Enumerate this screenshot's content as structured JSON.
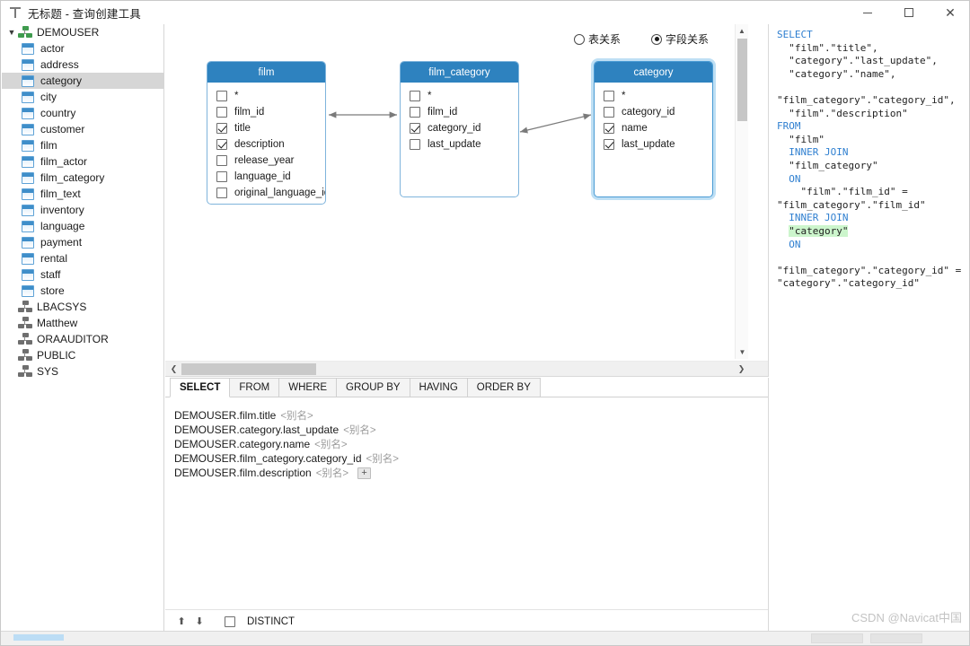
{
  "window": {
    "title": "无标题 - 查询创建工具",
    "minimize_label": "最小化",
    "maximize_label": "最大化",
    "close_label": "关闭"
  },
  "sidebar": {
    "root": {
      "label": "DEMOUSER",
      "icon": "schema-icon",
      "expanded": true
    },
    "tables": [
      {
        "label": "actor",
        "icon": "table-icon",
        "selected": false
      },
      {
        "label": "address",
        "icon": "table-icon",
        "selected": false
      },
      {
        "label": "category",
        "icon": "table-icon",
        "selected": true
      },
      {
        "label": "city",
        "icon": "table-icon",
        "selected": false
      },
      {
        "label": "country",
        "icon": "table-icon",
        "selected": false
      },
      {
        "label": "customer",
        "icon": "table-icon",
        "selected": false
      },
      {
        "label": "film",
        "icon": "table-icon",
        "selected": false
      },
      {
        "label": "film_actor",
        "icon": "table-icon",
        "selected": false
      },
      {
        "label": "film_category",
        "icon": "table-icon",
        "selected": false
      },
      {
        "label": "film_text",
        "icon": "table-icon",
        "selected": false
      },
      {
        "label": "inventory",
        "icon": "table-icon",
        "selected": false
      },
      {
        "label": "language",
        "icon": "table-icon",
        "selected": false
      },
      {
        "label": "payment",
        "icon": "table-icon",
        "selected": false
      },
      {
        "label": "rental",
        "icon": "table-icon",
        "selected": false
      },
      {
        "label": "staff",
        "icon": "table-icon",
        "selected": false
      },
      {
        "label": "store",
        "icon": "table-icon",
        "selected": false
      }
    ],
    "schemas": [
      {
        "label": "LBACSYS",
        "icon": "schema-icon"
      },
      {
        "label": "Matthew",
        "icon": "schema-icon"
      },
      {
        "label": "ORAAUDITOR",
        "icon": "schema-icon"
      },
      {
        "label": "PUBLIC",
        "icon": "schema-icon"
      },
      {
        "label": "SYS",
        "icon": "schema-icon"
      }
    ]
  },
  "canvas": {
    "relation_mode": {
      "table_label": "表关系",
      "field_label": "字段关系",
      "selected": "字段关系"
    },
    "tables": [
      {
        "name": "film",
        "active": false,
        "clipped": true,
        "columns": [
          {
            "label": "*",
            "checked": false
          },
          {
            "label": "film_id",
            "checked": false
          },
          {
            "label": "title",
            "checked": true
          },
          {
            "label": "description",
            "checked": true
          },
          {
            "label": "release_year",
            "checked": false
          },
          {
            "label": "language_id",
            "checked": false
          },
          {
            "label": "original_language_id",
            "checked": false
          }
        ]
      },
      {
        "name": "film_category",
        "active": false,
        "clipped": false,
        "columns": [
          {
            "label": "*",
            "checked": false
          },
          {
            "label": "film_id",
            "checked": false
          },
          {
            "label": "category_id",
            "checked": true
          },
          {
            "label": "last_update",
            "checked": false
          }
        ]
      },
      {
        "name": "category",
        "active": true,
        "clipped": false,
        "columns": [
          {
            "label": "*",
            "checked": false
          },
          {
            "label": "category_id",
            "checked": false
          },
          {
            "label": "name",
            "checked": true
          },
          {
            "label": "last_update",
            "checked": true
          }
        ]
      }
    ],
    "relations": [
      {
        "from": "film.film_id",
        "to": "film_category.film_id"
      },
      {
        "from": "film_category.category_id",
        "to": "category.category_id"
      }
    ],
    "vscroll": {
      "up_icon": "chevron-up-icon",
      "down_icon": "chevron-down-icon"
    },
    "hscroll": {
      "left_icon": "chevron-left-icon",
      "right_icon": "chevron-right-icon"
    }
  },
  "clause_panel": {
    "tabs": [
      {
        "label": "SELECT",
        "active": true
      },
      {
        "label": "FROM",
        "active": false
      },
      {
        "label": "WHERE",
        "active": false
      },
      {
        "label": "GROUP BY",
        "active": false
      },
      {
        "label": "HAVING",
        "active": false
      },
      {
        "label": "ORDER BY",
        "active": false
      }
    ],
    "fields": [
      {
        "field": "DEMOUSER.film.title",
        "alias": "<别名>",
        "add": false
      },
      {
        "field": "DEMOUSER.category.last_update",
        "alias": "<别名>",
        "add": false
      },
      {
        "field": "DEMOUSER.category.name",
        "alias": "<别名>",
        "add": false
      },
      {
        "field": "DEMOUSER.film_category.category_id",
        "alias": "<别名>",
        "add": false
      },
      {
        "field": "DEMOUSER.film.description",
        "alias": "<别名>",
        "add": true
      }
    ],
    "add_button_label": "+",
    "move_up_icon": "arrow-up-icon",
    "move_down_icon": "arrow-down-icon",
    "distinct": {
      "label": "DISTINCT",
      "checked": false
    }
  },
  "sql": {
    "lines": [
      {
        "segments": [
          {
            "t": "SELECT",
            "k": "kw"
          }
        ]
      },
      {
        "segments": [
          {
            "t": "  \"film\".\"title\","
          }
        ]
      },
      {
        "segments": [
          {
            "t": "  \"category\".\"last_update\","
          }
        ]
      },
      {
        "segments": [
          {
            "t": "  \"category\".\"name\","
          }
        ]
      },
      {
        "segments": [
          {
            "t": "  \"film_category\".\"category_id\","
          }
        ]
      },
      {
        "segments": [
          {
            "t": "  \"film\".\"description\""
          }
        ]
      },
      {
        "segments": [
          {
            "t": "FROM",
            "k": "kw"
          }
        ]
      },
      {
        "segments": [
          {
            "t": "  \"film\""
          }
        ]
      },
      {
        "segments": [
          {
            "t": "  "
          },
          {
            "t": "INNER JOIN",
            "k": "kw"
          }
        ]
      },
      {
        "segments": [
          {
            "t": "  \"film_category\""
          }
        ]
      },
      {
        "segments": [
          {
            "t": "  "
          },
          {
            "t": "ON",
            "k": "kw"
          }
        ]
      },
      {
        "segments": [
          {
            "t": "    \"film\".\"film_id\" = \"film_category\".\"film_id\""
          }
        ]
      },
      {
        "segments": [
          {
            "t": "  "
          },
          {
            "t": "INNER JOIN",
            "k": "kw"
          }
        ]
      },
      {
        "segments": [
          {
            "t": "  "
          },
          {
            "t": "\"category\"",
            "k": "hl"
          }
        ]
      },
      {
        "segments": [
          {
            "t": "  "
          },
          {
            "t": "ON",
            "k": "kw"
          }
        ]
      },
      {
        "segments": [
          {
            "t": "    \"film_category\".\"category_id\" = \"category\".\"category_id\""
          }
        ]
      }
    ],
    "watermark": "CSDN @Navicat中国"
  },
  "colors": {
    "header_blue": "#2e82bf",
    "keyword_blue": "#2f7fd0",
    "highlight_green": "#ccf5cc",
    "selection_gray": "#d6d6d6",
    "table_border_blue": "#7fb4dc"
  }
}
